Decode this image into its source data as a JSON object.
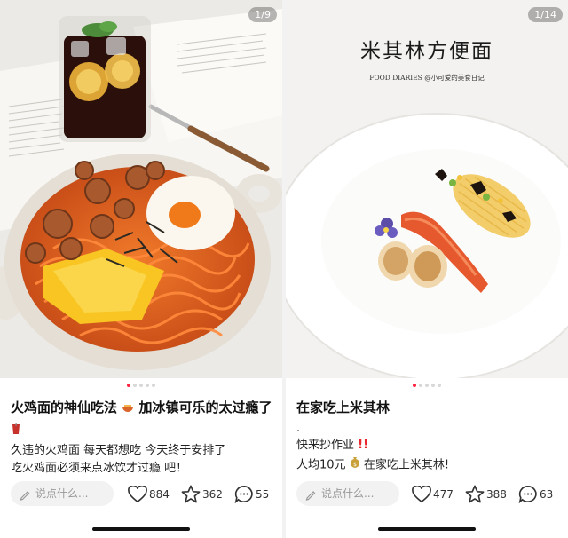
{
  "posts": [
    {
      "counter": "1/9",
      "title": "火鸡面的神仙吃法",
      "title_suffix": "加冰镇可乐的太过瘾了",
      "body_lines": [
        "久违的火鸡面 每天都想吃 今天终于安排了",
        "吃火鸡面必须来点冰饮才过瘾 吧！"
      ],
      "comment_placeholder": "说点什么...",
      "likes": "884",
      "stars": "362",
      "comments": "55"
    },
    {
      "counter": "1/14",
      "image_title": "米其林方便面",
      "image_subtitle": "FOOD DIARIES @小可爱的美食日记",
      "title": "在家吃上米其林",
      "body_lines": [
        ".",
        "快来抄作业",
        "人均10元",
        "在家吃上米其林!"
      ],
      "comment_placeholder": "说点什么...",
      "likes": "477",
      "stars": "388",
      "comments": "63"
    }
  ],
  "colors": {
    "accent": "#ff2442",
    "muted": "#999999"
  }
}
